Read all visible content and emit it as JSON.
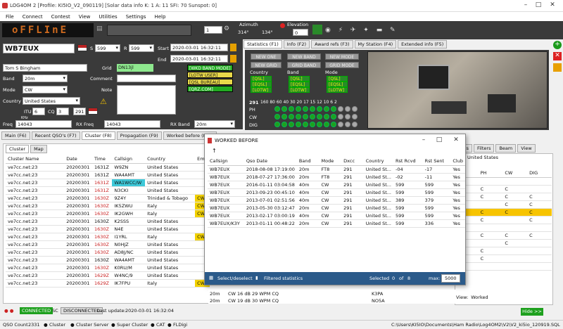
{
  "window": {
    "title": "LOG4OM 2 [Profile: KI5IO_V2_090119] [Solar data info K: 1 A: 11 SFI: 70 Sunspot: 0]"
  },
  "menu": [
    "File",
    "Connect",
    "Contest",
    "View",
    "Utilities",
    "Settings",
    "Help"
  ],
  "led": "oFFLInE",
  "rig": {
    "value": "1",
    "azimuth_label": "Azimuth",
    "az1": "314°",
    "az2": "134°",
    "elevation_label": "Elevation",
    "elevation": "0"
  },
  "qso": {
    "callsign": "WB7EUX",
    "rst_s": "599",
    "rst_r": "599",
    "start_label": "Start",
    "start": "2020-03-01 16:32:11",
    "end_label": "End",
    "end": "2020-03-01 16:32:11",
    "name": "Tom S Bingham",
    "grid_label": "Grid",
    "grid": "DN13jl",
    "band_label": "Band",
    "band": "20m",
    "comment_label": "Comment",
    "mode_label": "Mode",
    "mode": "CW",
    "note_label": "Note",
    "country_label": "Country",
    "country": "United States",
    "itu_label": "ITU",
    "itu": "6",
    "cq_label": "CQ",
    "cq": "3",
    "dxcc": "291",
    "freq_label": "Freq",
    "freq": "14043",
    "khz": "KHz",
    "rxfreq_label": "RX Freq",
    "rxfreq": "14043",
    "rxband_label": "RX Band",
    "rxband": "20m"
  },
  "badges": [
    "[WKD BAND MODE]",
    "[LOTW USER]",
    "[QSL BUREAU]",
    "[QRZ.COM]"
  ],
  "right_tabs": [
    "Statistics (F1)",
    "Info (F2)",
    "Award refs (F3)",
    "My Station (F4)",
    "Extended info (F5)"
  ],
  "stats": {
    "buttons": [
      "NEW ONE",
      "NEW BAND",
      "NEW MODE",
      "NEW GRID",
      "GRID BAND",
      "GRID MODE"
    ],
    "country_label": "Country",
    "band_label": "Band",
    "mode_label": "Mode",
    "qsl": [
      "[QSL]",
      "[EQSL]",
      "[LOTW]"
    ],
    "dxcc": "291",
    "bands_header": "160 80 60 40 30 20 17 15 12 10 6 2",
    "ph": "PH",
    "cw": "CW",
    "dig": "DIG"
  },
  "main_tabs": [
    "Main (F6)",
    "Recent QSO's (F7)",
    "Cluster (F8)",
    "Propagation (F9)",
    "Worked before (F10)"
  ],
  "cluster_tabs": [
    "Cluster",
    "Map"
  ],
  "cluster": {
    "headers": [
      "Cluster Name",
      "Date",
      "Time",
      "Callsign",
      "Country",
      "Eme"
    ],
    "rows": [
      [
        "ve7cc.net:23",
        "20200301",
        "1631Z",
        "W9ZN",
        "United States",
        ""
      ],
      [
        "ve7cc.net:23",
        "20200301",
        "1631Z",
        "WA4AMT",
        "United States",
        ""
      ],
      [
        "ve7cc.net:23",
        "20200301",
        "1631Z",
        "WA1WCC/W",
        "United States",
        ""
      ],
      [
        "ve7cc.net:23",
        "20200301",
        "1631Z",
        "N3CKI",
        "United States",
        ""
      ],
      [
        "ve7cc.net:23",
        "20200301",
        "1630Z",
        "9Z4Y",
        "Trinidad & Tobago",
        "CW"
      ],
      [
        "ve7cc.net:23",
        "20200301",
        "1630Z",
        "IK5ZWU",
        "Italy",
        "CW"
      ],
      [
        "ve7cc.net:23",
        "20200301",
        "1630Z",
        "IK2GWH",
        "Italy",
        "CW"
      ],
      [
        "ve7cc.net:23",
        "20200301",
        "1630Z",
        "K2SSS",
        "United States",
        ""
      ],
      [
        "ve7cc.net:23",
        "20200301",
        "1630Z",
        "N4E",
        "United States",
        ""
      ],
      [
        "ve7cc.net:23",
        "20200301",
        "1630Z",
        "I1YRL",
        "Italy",
        "CW"
      ],
      [
        "ve7cc.net:23",
        "20200301",
        "1630Z",
        "N0HJZ",
        "United States",
        ""
      ],
      [
        "ve7cc.net:23",
        "20200301",
        "1630Z",
        "AD8J/NC",
        "United States",
        ""
      ],
      [
        "ve7cc.net:23",
        "20200301",
        "1630Z",
        "WA4AMT",
        "United States",
        ""
      ],
      [
        "ve7cc.net:23",
        "20200301",
        "1630Z",
        "K0RU/M",
        "United States",
        ""
      ],
      [
        "ve7cc.net:23",
        "20200301",
        "1629Z",
        "W4NC/9",
        "United States",
        ""
      ],
      [
        "ve7cc.net:23",
        "20200301",
        "1629Z",
        "IK7FPU",
        "Italy",
        "CW"
      ]
    ]
  },
  "wb": {
    "title": "WORKED BEFORE",
    "headers": [
      "Callsign",
      "Qso Date",
      "Band",
      "Mode",
      "Dxcc",
      "Country",
      "Rst Rcvd",
      "Rst Sent",
      "Club"
    ],
    "rows": [
      [
        "WB7EUX",
        "2018-08-08 17:19:00",
        "20m",
        "FT8",
        "291",
        "United St...",
        "-04",
        "-17",
        "Yes"
      ],
      [
        "WB7EUX",
        "2018-07-27 17:36:00",
        "20m",
        "FT8",
        "291",
        "United St...",
        "-02",
        "-11",
        "Yes"
      ],
      [
        "WB7EUX",
        "2016-01-11 03:04:58",
        "40m",
        "CW",
        "291",
        "United St...",
        "599",
        "599",
        "Yes"
      ],
      [
        "WB7EUX",
        "2013-09-23 00:45:10",
        "40m",
        "CW",
        "291",
        "United St...",
        "599",
        "599",
        "Yes"
      ],
      [
        "WB7EUX",
        "2013-07-01 02:51:56",
        "40m",
        "CW",
        "291",
        "United St...",
        "389",
        "379",
        "Yes"
      ],
      [
        "WB7EUX",
        "2013-05-30 03:12:47",
        "20m",
        "CW",
        "291",
        "United St...",
        "599",
        "599",
        "Yes"
      ],
      [
        "WB7EUX",
        "2013-02-17 03:00:19",
        "40m",
        "CW",
        "291",
        "United St...",
        "599",
        "599",
        "Yes"
      ],
      [
        "WB7EUX/K3Y",
        "2013-01-11 00:48:22",
        "20m",
        "CW",
        "291",
        "United St...",
        "599",
        "336",
        "Yes"
      ]
    ],
    "select_label": "Select/deselect",
    "filtered_label": "Filtered statistics",
    "selected_label": "Selected",
    "selected": "0",
    "of_label": "of",
    "total": "8",
    "max_label": "max:",
    "max": "5000"
  },
  "spots": {
    "tabs": [
      "...ics",
      "Filters",
      "Beam",
      "View"
    ],
    "country": "United States",
    "headers": [
      "PH",
      "CW",
      "DIG"
    ],
    "view_label": "View:",
    "view": "Worked",
    "hide": "Hide >>"
  },
  "spot_tail": [
    "20m",
    "CW 16 dB 29 WPM CQ",
    "K3PA",
    "20m",
    "CW 19 dB 30 WPM CQ",
    "NO5A"
  ],
  "status": {
    "connected": "CONNECTED",
    "sc": "SC",
    "disconnected": "DISCONNECTED",
    "last_update_label": "Last update:",
    "last_update": "2020-03-01 16:32:04",
    "qso_count_label": "QSO Count",
    "qso_count": "2331",
    "items": [
      "Cluster",
      "Cluster Server",
      "Super Cluster",
      "CAT",
      "FLDigi"
    ],
    "path": "C:\\Users\\KI5IO\\Documents\\Ham Radio\\Log4OM2\\V2\\V2_ki5io_120919.SQLite"
  },
  "colors": {
    "led": "#d06a1e",
    "accent_green": "#22aa22",
    "cw_yellow": "#f2d100",
    "cyan": "#3ec8d8"
  }
}
